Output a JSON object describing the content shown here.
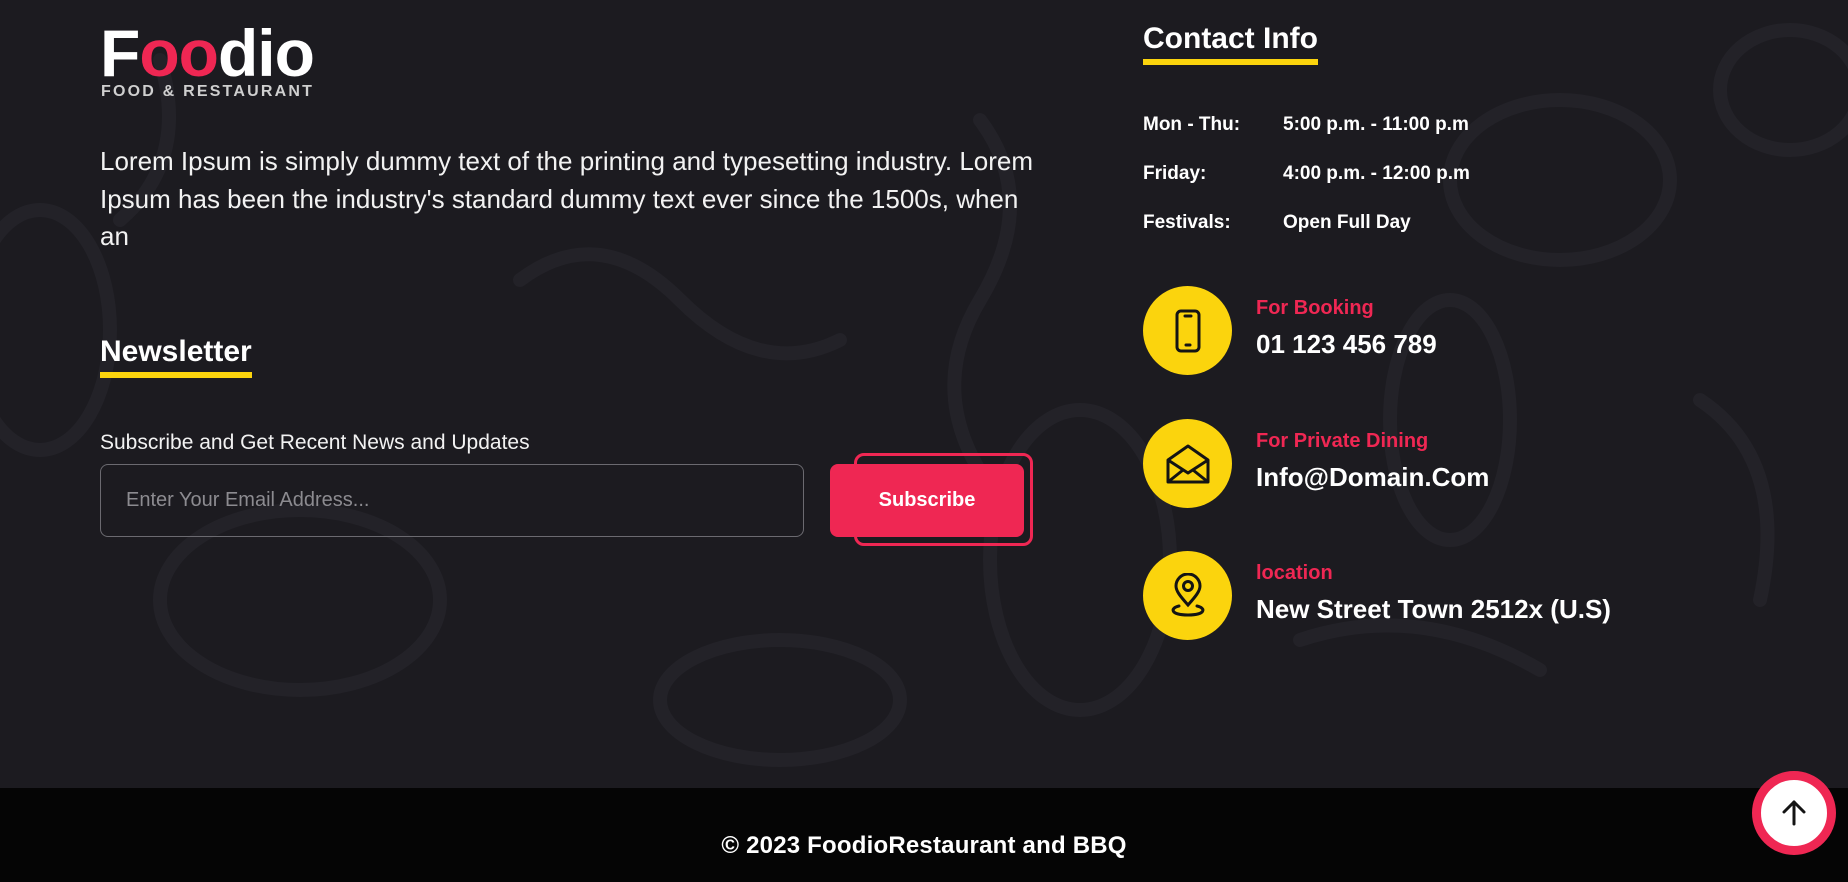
{
  "logo": {
    "name_part1": "F",
    "name_part2": "oo",
    "name_part3": "dio",
    "tagline": "FOOD & RESTAURANT"
  },
  "about": {
    "text": "Lorem Ipsum is simply dummy text of the printing and typesetting industry. Lorem Ipsum has been the industry's standard dummy text ever since the 1500s, when an"
  },
  "newsletter": {
    "title": "Newsletter",
    "label": "Subscribe and Get Recent News and Updates",
    "email_value": "",
    "email_placeholder": "Enter Your Email Address...",
    "button_label": "Subscribe"
  },
  "contact": {
    "title": "Contact Info",
    "hours": [
      {
        "day": "Mon - Thu:",
        "time": "5:00 p.m. - 11:00 p.m"
      },
      {
        "day": "Friday:",
        "time": "4:00 p.m. - 12:00 p.m"
      },
      {
        "day": "Festivals:",
        "time": "Open Full Day"
      }
    ],
    "items": [
      {
        "icon": "phone-icon",
        "label": "For Booking",
        "value": "01 123 456 789"
      },
      {
        "icon": "envelope-icon",
        "label": "For Private Dining",
        "value": "Info@Domain.Com"
      },
      {
        "icon": "location-pin-icon",
        "label": "location",
        "value": "New Street Town 2512x (U.S)"
      }
    ]
  },
  "footer": {
    "copyright": "© 2023 FoodioRestaurant and BBQ"
  },
  "back_to_top": {
    "icon": "arrow-up-icon"
  },
  "colors": {
    "background": "#1c1b20",
    "bottom_bar": "#050505",
    "accent_red": "#ef2753",
    "accent_yellow": "#fbd40d",
    "text": "#ffffff"
  }
}
